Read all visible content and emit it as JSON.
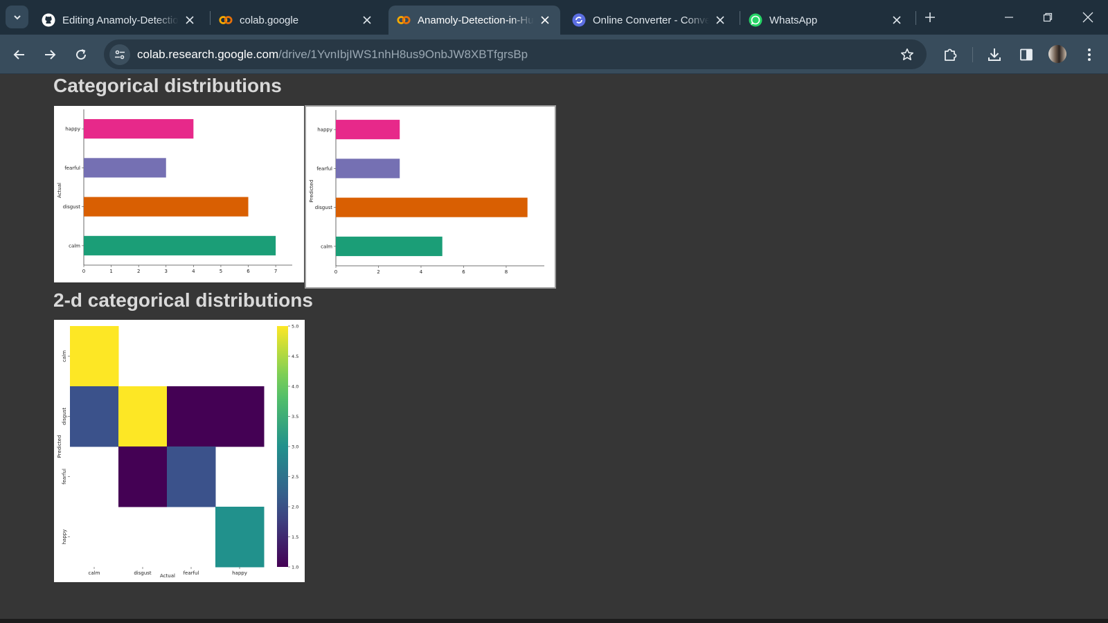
{
  "browser": {
    "tabs": [
      {
        "title": "Editing Anamoly-Detection-in-Human-Audio",
        "icon": "github-icon",
        "active": false
      },
      {
        "title": "colab.google",
        "icon": "colab-icon",
        "active": false
      },
      {
        "title": "Anamoly-Detection-in-Human-Audio",
        "icon": "colab-icon",
        "active": true
      },
      {
        "title": "Online Converter - Convert",
        "icon": "converter-icon",
        "active": false
      },
      {
        "title": "WhatsApp",
        "icon": "whatsapp-icon",
        "active": false
      }
    ],
    "url_host": "colab.research.google.com",
    "url_path": "/drive/1YvnIbjIWS1nhH8us9OnbJW8XBTfgrsBp"
  },
  "notebook": {
    "section1_title": "Categorical distributions",
    "section2_title": "2-d categorical distributions"
  },
  "chart_data": [
    {
      "type": "bar",
      "orientation": "horizontal",
      "categories": [
        "happy",
        "fearful",
        "disgust",
        "calm"
      ],
      "values": [
        4,
        3,
        6,
        7
      ],
      "colors": [
        "#e7298a",
        "#7570b3",
        "#d95f02",
        "#1b9e77"
      ],
      "xlabel": "",
      "ylabel": "Actual",
      "xlim": [
        0,
        7.3
      ],
      "xticks": [
        0,
        1,
        2,
        3,
        4,
        5,
        6,
        7
      ]
    },
    {
      "type": "bar",
      "orientation": "horizontal",
      "categories": [
        "happy",
        "fearful",
        "disgust",
        "calm"
      ],
      "values": [
        3,
        3,
        9,
        5
      ],
      "colors": [
        "#e7298a",
        "#7570b3",
        "#d95f02",
        "#1b9e77"
      ],
      "xlabel": "",
      "ylabel": "Predicted",
      "xlim": [
        0,
        9.4
      ],
      "xticks": [
        0,
        2,
        4,
        6,
        8
      ]
    },
    {
      "type": "heatmap",
      "x_categories": [
        "calm",
        "disgust",
        "fearful",
        "happy"
      ],
      "y_categories": [
        "calm",
        "disgust",
        "fearful",
        "happy"
      ],
      "xlabel": "Actual",
      "ylabel": "Predicted",
      "colormap": "viridis",
      "cells": [
        {
          "x": "calm",
          "y": "calm",
          "value": 5
        },
        {
          "x": "calm",
          "y": "disgust",
          "value": 2
        },
        {
          "x": "disgust",
          "y": "disgust",
          "value": 5
        },
        {
          "x": "fearful",
          "y": "disgust",
          "value": 1
        },
        {
          "x": "happy",
          "y": "disgust",
          "value": 1
        },
        {
          "x": "disgust",
          "y": "fearful",
          "value": 1
        },
        {
          "x": "fearful",
          "y": "fearful",
          "value": 2
        },
        {
          "x": "happy",
          "y": "happy",
          "value": 3
        }
      ],
      "colorbar_range": [
        1.0,
        5.0
      ],
      "colorbar_ticks": [
        "1.0",
        "1.5",
        "2.0",
        "2.5",
        "3.0",
        "3.5",
        "4.0",
        "4.5",
        "5.0"
      ]
    }
  ]
}
